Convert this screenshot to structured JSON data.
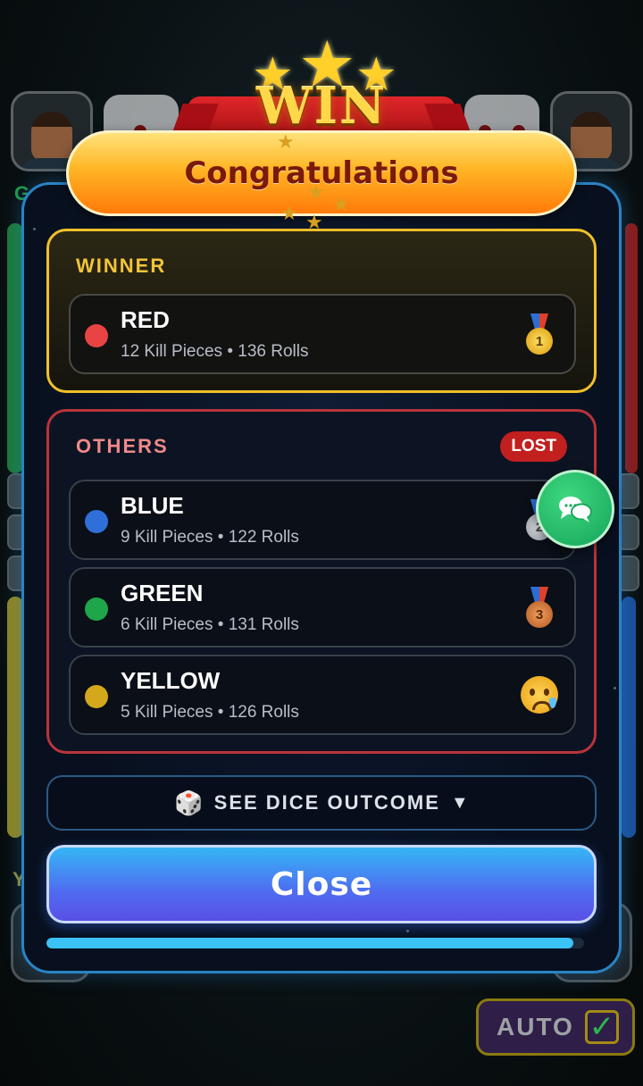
{
  "banner": {
    "win_text": "WIN"
  },
  "header": {
    "title": "Congratulations"
  },
  "background": {
    "left_player_label": "Gr",
    "left_bottom_label": "Y",
    "auto_button_label": "AUTO"
  },
  "winner_section": {
    "title": "WINNER",
    "player": {
      "name": "RED",
      "stats": "12 Kill Pieces • 136 Rolls",
      "color": "#e84444",
      "icon": "gold-medal-icon"
    }
  },
  "others_section": {
    "title": "OTHERS",
    "badge": "LOST",
    "players": [
      {
        "name": "BLUE",
        "stats": "9 Kill Pieces • 122 Rolls",
        "color": "#2f6fd8",
        "icon": "silver-medal-icon"
      },
      {
        "name": "GREEN",
        "stats": "6 Kill Pieces • 131 Rolls",
        "color": "#1fa54a",
        "icon": "bronze-medal-icon"
      },
      {
        "name": "YELLOW",
        "stats": "5 Kill Pieces • 126 Rolls",
        "color": "#d4a81a",
        "icon": "crying-face-icon"
      }
    ]
  },
  "dice_outcome": {
    "label": "SEE DICE OUTCOME",
    "icon": "dice-icon",
    "arrow": "▼"
  },
  "close_button": {
    "label": "Close"
  },
  "progress": {
    "fraction": 0.98
  },
  "colors": {
    "accent": "#2a83c4",
    "winner_border": "#f0c02a",
    "others_border": "#b8343a",
    "close_gradient_top": "#35b6f5",
    "close_gradient_bottom": "#5a4fe6"
  }
}
